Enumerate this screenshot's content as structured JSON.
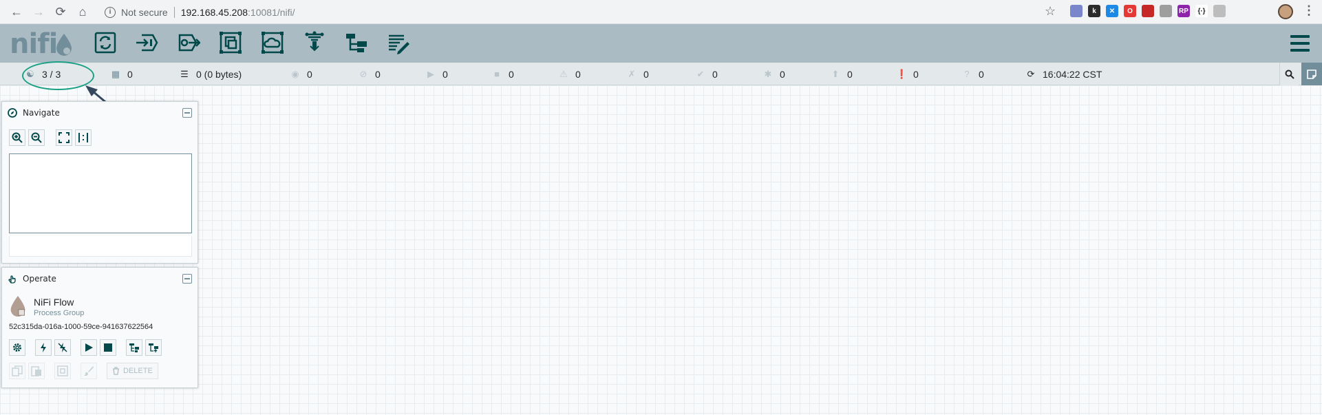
{
  "browser": {
    "security_label": "Not secure",
    "url_host": "192.168.45.208",
    "url_path": ":10081/nifi/",
    "extensions": [
      {
        "icon": "globe-ext-icon",
        "color": "#7986cb",
        "label": ""
      },
      {
        "icon": "k-ext-icon",
        "color": "#2b2b2b",
        "label": "k"
      },
      {
        "icon": "x-ext-icon",
        "color": "#1e88e5",
        "label": "✕"
      },
      {
        "icon": "shield-red-ext-icon",
        "color": "#e53935",
        "label": "O"
      },
      {
        "icon": "book-ext-icon",
        "color": "#c62828",
        "label": ""
      },
      {
        "icon": "shield-ext-icon",
        "color": "#9e9e9e",
        "label": ""
      },
      {
        "icon": "jsrp-ext-icon",
        "color": "#8e24aa",
        "label": "RP"
      },
      {
        "icon": "braces-ext-icon",
        "color": "#ffffff",
        "label": "{·}"
      },
      {
        "icon": "puzzle-ext-icon",
        "color": "#bdbdbd",
        "label": ""
      }
    ]
  },
  "nifi": {
    "logo_text": "nifi",
    "toolbar": [
      {
        "name": "processor-icon"
      },
      {
        "name": "input-port-icon"
      },
      {
        "name": "output-port-icon"
      },
      {
        "name": "process-group-icon"
      },
      {
        "name": "remote-process-group-icon"
      },
      {
        "name": "funnel-icon"
      },
      {
        "name": "template-icon"
      },
      {
        "name": "label-icon"
      }
    ],
    "status": {
      "cluster": "3 / 3",
      "threads": "0",
      "queued": "0 (0 bytes)",
      "transmitting": "0",
      "not_transmitting": "0",
      "running": "0",
      "stopped": "0",
      "invalid": "0",
      "disabled": "0",
      "up_to_date": "0",
      "locally_modified": "0",
      "stale": "0",
      "locally_modified_stale": "0",
      "sync_failure": "0",
      "last_refreshed": "16:04:22 CST"
    },
    "navigate": {
      "title": "Navigate"
    },
    "operate": {
      "title": "Operate",
      "component_name": "NiFi Flow",
      "component_type": "Process Group",
      "component_id": "52c315da-016a-1000-59ce-941637622564",
      "delete_label": "DELETE"
    }
  },
  "colors": {
    "header_bg": "#aabbc3",
    "status_bg": "#e3e8eb",
    "icon_dark": "#004849",
    "icon_muted": "#728e9b",
    "annotation": "#1aa085"
  }
}
